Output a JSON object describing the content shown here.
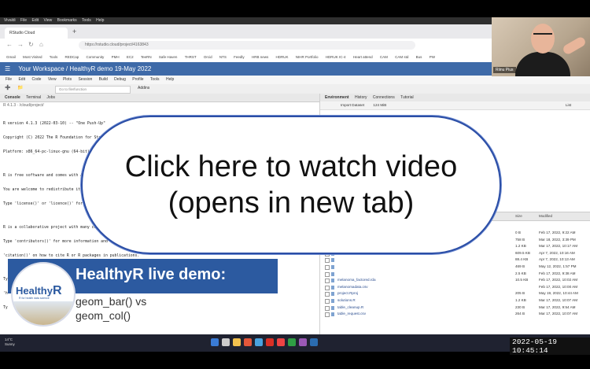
{
  "os_menubar": [
    "Vivaldi",
    "File",
    "Edit",
    "View",
    "Bookmarks",
    "Tools",
    "Help"
  ],
  "browser": {
    "tab_title": "RStudio Cloud",
    "new_tab_glyph": "+",
    "url": "https://rstudio.cloud/project/4163843",
    "bookmarks": [
      "Gmail",
      "Most Visited",
      "Tools",
      "REDCap",
      "Community",
      "PMH",
      "EC2",
      "TeeRN",
      "Safe Haven",
      "THRST",
      "Orcid",
      "NTS",
      "Feedly",
      "HRB news",
      "HDRUK",
      "NIHR Portfolio",
      "HDRUK IC-4",
      "Heart attend",
      "CAM",
      "CAM std",
      "Bus",
      "PW"
    ]
  },
  "workspace": {
    "title": "Your Workspace / HealthyR demo 19-May 2022"
  },
  "rstudio_menu": [
    "File",
    "Edit",
    "Code",
    "View",
    "Plots",
    "Session",
    "Build",
    "Debug",
    "Profile",
    "Tools",
    "Help"
  ],
  "toolbar": {
    "goto_file": "Go to file/function",
    "addins": "Addins"
  },
  "console": {
    "tabs": [
      "Console",
      "Terminal",
      "Jobs"
    ],
    "path": "R 4.1.3 · /cloud/project/",
    "lines": [
      "R version 4.1.3 (2022-03-10) -- \"One Push-Up\"",
      "Copyright (C) 2022 The R Foundation for Statistical Computing",
      "Platform: x86_64-pc-linux-gnu (64-bit)",
      "",
      "R is free software and comes with ABSOLUTELY NO WARRANTY.",
      "You are welcome to redistribute it under certain conditions.",
      "Type 'license()' or 'licence()' for distribution details.",
      "",
      "R is a collaborative project with many contributors.",
      "Type 'contributors()' for more information and",
      "'citation()' on how to cite R or R packages in publications.",
      "",
      "Type 'demo()' for some demos, 'help()' for on-line help, or",
      "'help.start()' for an HTML browser interface to help.",
      "Type 'q()' to quit R."
    ]
  },
  "environment": {
    "tabs": [
      "Environment",
      "History",
      "Connections",
      "Tutorial"
    ],
    "import": "Import Dataset",
    "memory": "124 MiB",
    "list_label": "List"
  },
  "files": {
    "col_size": "Size",
    "col_modified": "Modified",
    "rows": [
      {
        "name": "",
        "size": "0 B",
        "modified": "Feb 17, 2022, 9:22 AM"
      },
      {
        "name": "",
        "size": "758 B",
        "modified": "Mar 18, 2022, 3:39 PM"
      },
      {
        "name": "",
        "size": "1.2 KB",
        "modified": "Mar 17, 2022, 10:17 AM"
      },
      {
        "name": "",
        "size": "609.5 KB",
        "modified": "Apr 7, 2022, 10:16 AM"
      },
      {
        "name": "",
        "size": "88.4 KB",
        "modified": "Apr 7, 2022, 10:13 AM"
      },
      {
        "name": "",
        "size": "469 B",
        "modified": "May 12, 2022, 1:57 PM"
      },
      {
        "name": "",
        "size": "2.5 KB",
        "modified": "Feb 17, 2022, 9:38 AM"
      },
      {
        "name": "melanoma_factored.rda",
        "size": "10.5 KB",
        "modified": "Feb 17, 2022, 10:02 AM"
      },
      {
        "name": "melanomadata.csv",
        "size": "",
        "modified": "Feb 17, 2022, 10:00 AM"
      },
      {
        "name": "project.Rproj",
        "size": "205 B",
        "modified": "May 19, 2022, 10:44 AM"
      },
      {
        "name": "solutions.R",
        "size": "1.2 KB",
        "modified": "Mar 17, 2022, 10:07 AM"
      },
      {
        "name": "table_cleanup.R",
        "size": "230 B",
        "modified": "Mar 17, 2022, 9:54 AM"
      },
      {
        "name": "table_request.csv",
        "size": "264 B",
        "modified": "Mar 17, 2022, 10:07 AM"
      }
    ]
  },
  "webcam": {
    "name": "Riinu Pius"
  },
  "taskbar": {
    "weather_temp": "14°C",
    "weather_desc": "Sunny",
    "icon_colors": [
      "#3a7bd5",
      "#cccccc",
      "#f2c14e",
      "#e3573a",
      "#4aa3df",
      "#d93025",
      "#e44",
      "#2f9e44",
      "#9b59b6",
      "#2b6cb0"
    ],
    "datetime": "2022-05-19  10:45:14"
  },
  "overlay": {
    "line1": "Click here to watch video",
    "line2": "(opens in new tab)"
  },
  "banner": {
    "logo_text": "Healthy",
    "logo_r": "R",
    "logo_sub": "R for health data science",
    "title": "HealthyR live demo:",
    "line1": "geom_bar() vs",
    "line2": "geom_col()"
  }
}
